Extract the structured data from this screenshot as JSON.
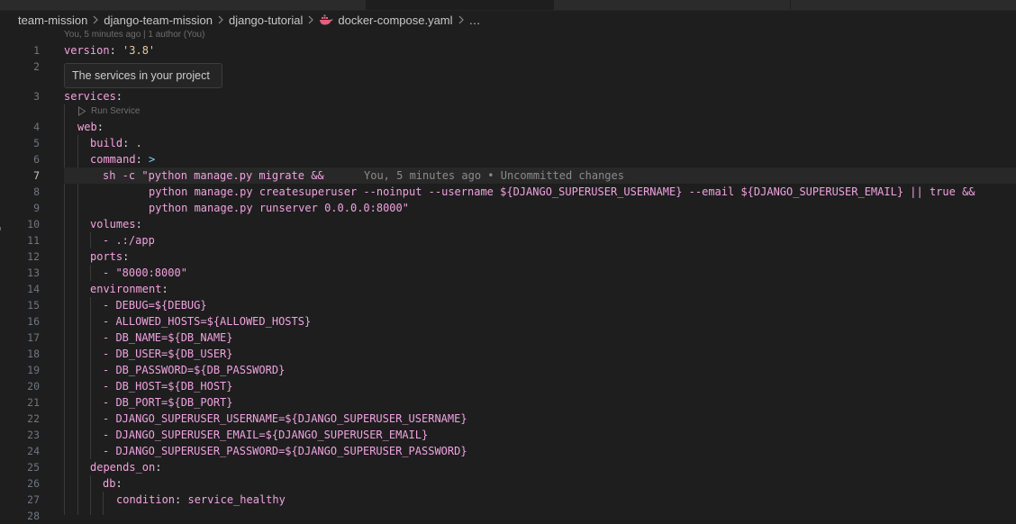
{
  "breadcrumb": {
    "items": [
      "team-mission",
      "django-team-mission",
      "django-tutorial",
      "docker-compose.yaml",
      "…"
    ],
    "file_icon": "docker-whale-icon"
  },
  "blame_header": "You, 5 minutes ago | 1 author (You)",
  "hover_tooltip": "The services in your project",
  "codelens": "Run Service",
  "inline_blame": "You, 5 minutes ago • Uncommitted changes",
  "active_line": 7,
  "line_numbers": [
    "1",
    "2",
    "3",
    "4",
    "5",
    "6",
    "7",
    "8",
    "9",
    "10",
    "11",
    "12",
    "13",
    "14",
    "15",
    "16",
    "17",
    "18",
    "19",
    "20",
    "21",
    "22",
    "23",
    "24",
    "25",
    "26",
    "27",
    "28"
  ],
  "code": {
    "l1_key": "version",
    "l1_val": "'3.8'",
    "l3_key": "services",
    "l4_key": "web",
    "l5_key": "build",
    "l5_val": ".",
    "l6_key": "command",
    "l6_val": ">",
    "l7": "sh -c \"python manage.py migrate &&",
    "l8": "python manage.py createsuperuser --noinput --username ${DJANGO_SUPERUSER_USERNAME} --email ${DJANGO_SUPERUSER_EMAIL} || true &&",
    "l9": "python manage.py runserver 0.0.0.0:8000\"",
    "l10_key": "volumes",
    "l11": "- .:/app",
    "l12_key": "ports",
    "l13": "- \"8000:8000\"",
    "l14_key": "environment",
    "l15": "- DEBUG=${DEBUG}",
    "l16": "- ALLOWED_HOSTS=${ALLOWED_HOSTS}",
    "l17": "- DB_NAME=${DB_NAME}",
    "l18": "- DB_USER=${DB_USER}",
    "l19": "- DB_PASSWORD=${DB_PASSWORD}",
    "l20": "- DB_HOST=${DB_HOST}",
    "l21": "- DB_PORT=${DB_PORT}",
    "l22": "- DJANGO_SUPERUSER_USERNAME=${DJANGO_SUPERUSER_USERNAME}",
    "l23": "- DJANGO_SUPERUSER_EMAIL=${DJANGO_SUPERUSER_EMAIL}",
    "l24": "- DJANGO_SUPERUSER_PASSWORD=${DJANGO_SUPERUSER_PASSWORD}",
    "l25_key": "depends_on",
    "l26_key": "db",
    "l27_key": "condition",
    "l27_val": "service_healthy"
  },
  "colors": {
    "background": "#1e1e1e",
    "yaml_key": "#f7a2e0",
    "line_number": "#6e7681"
  }
}
